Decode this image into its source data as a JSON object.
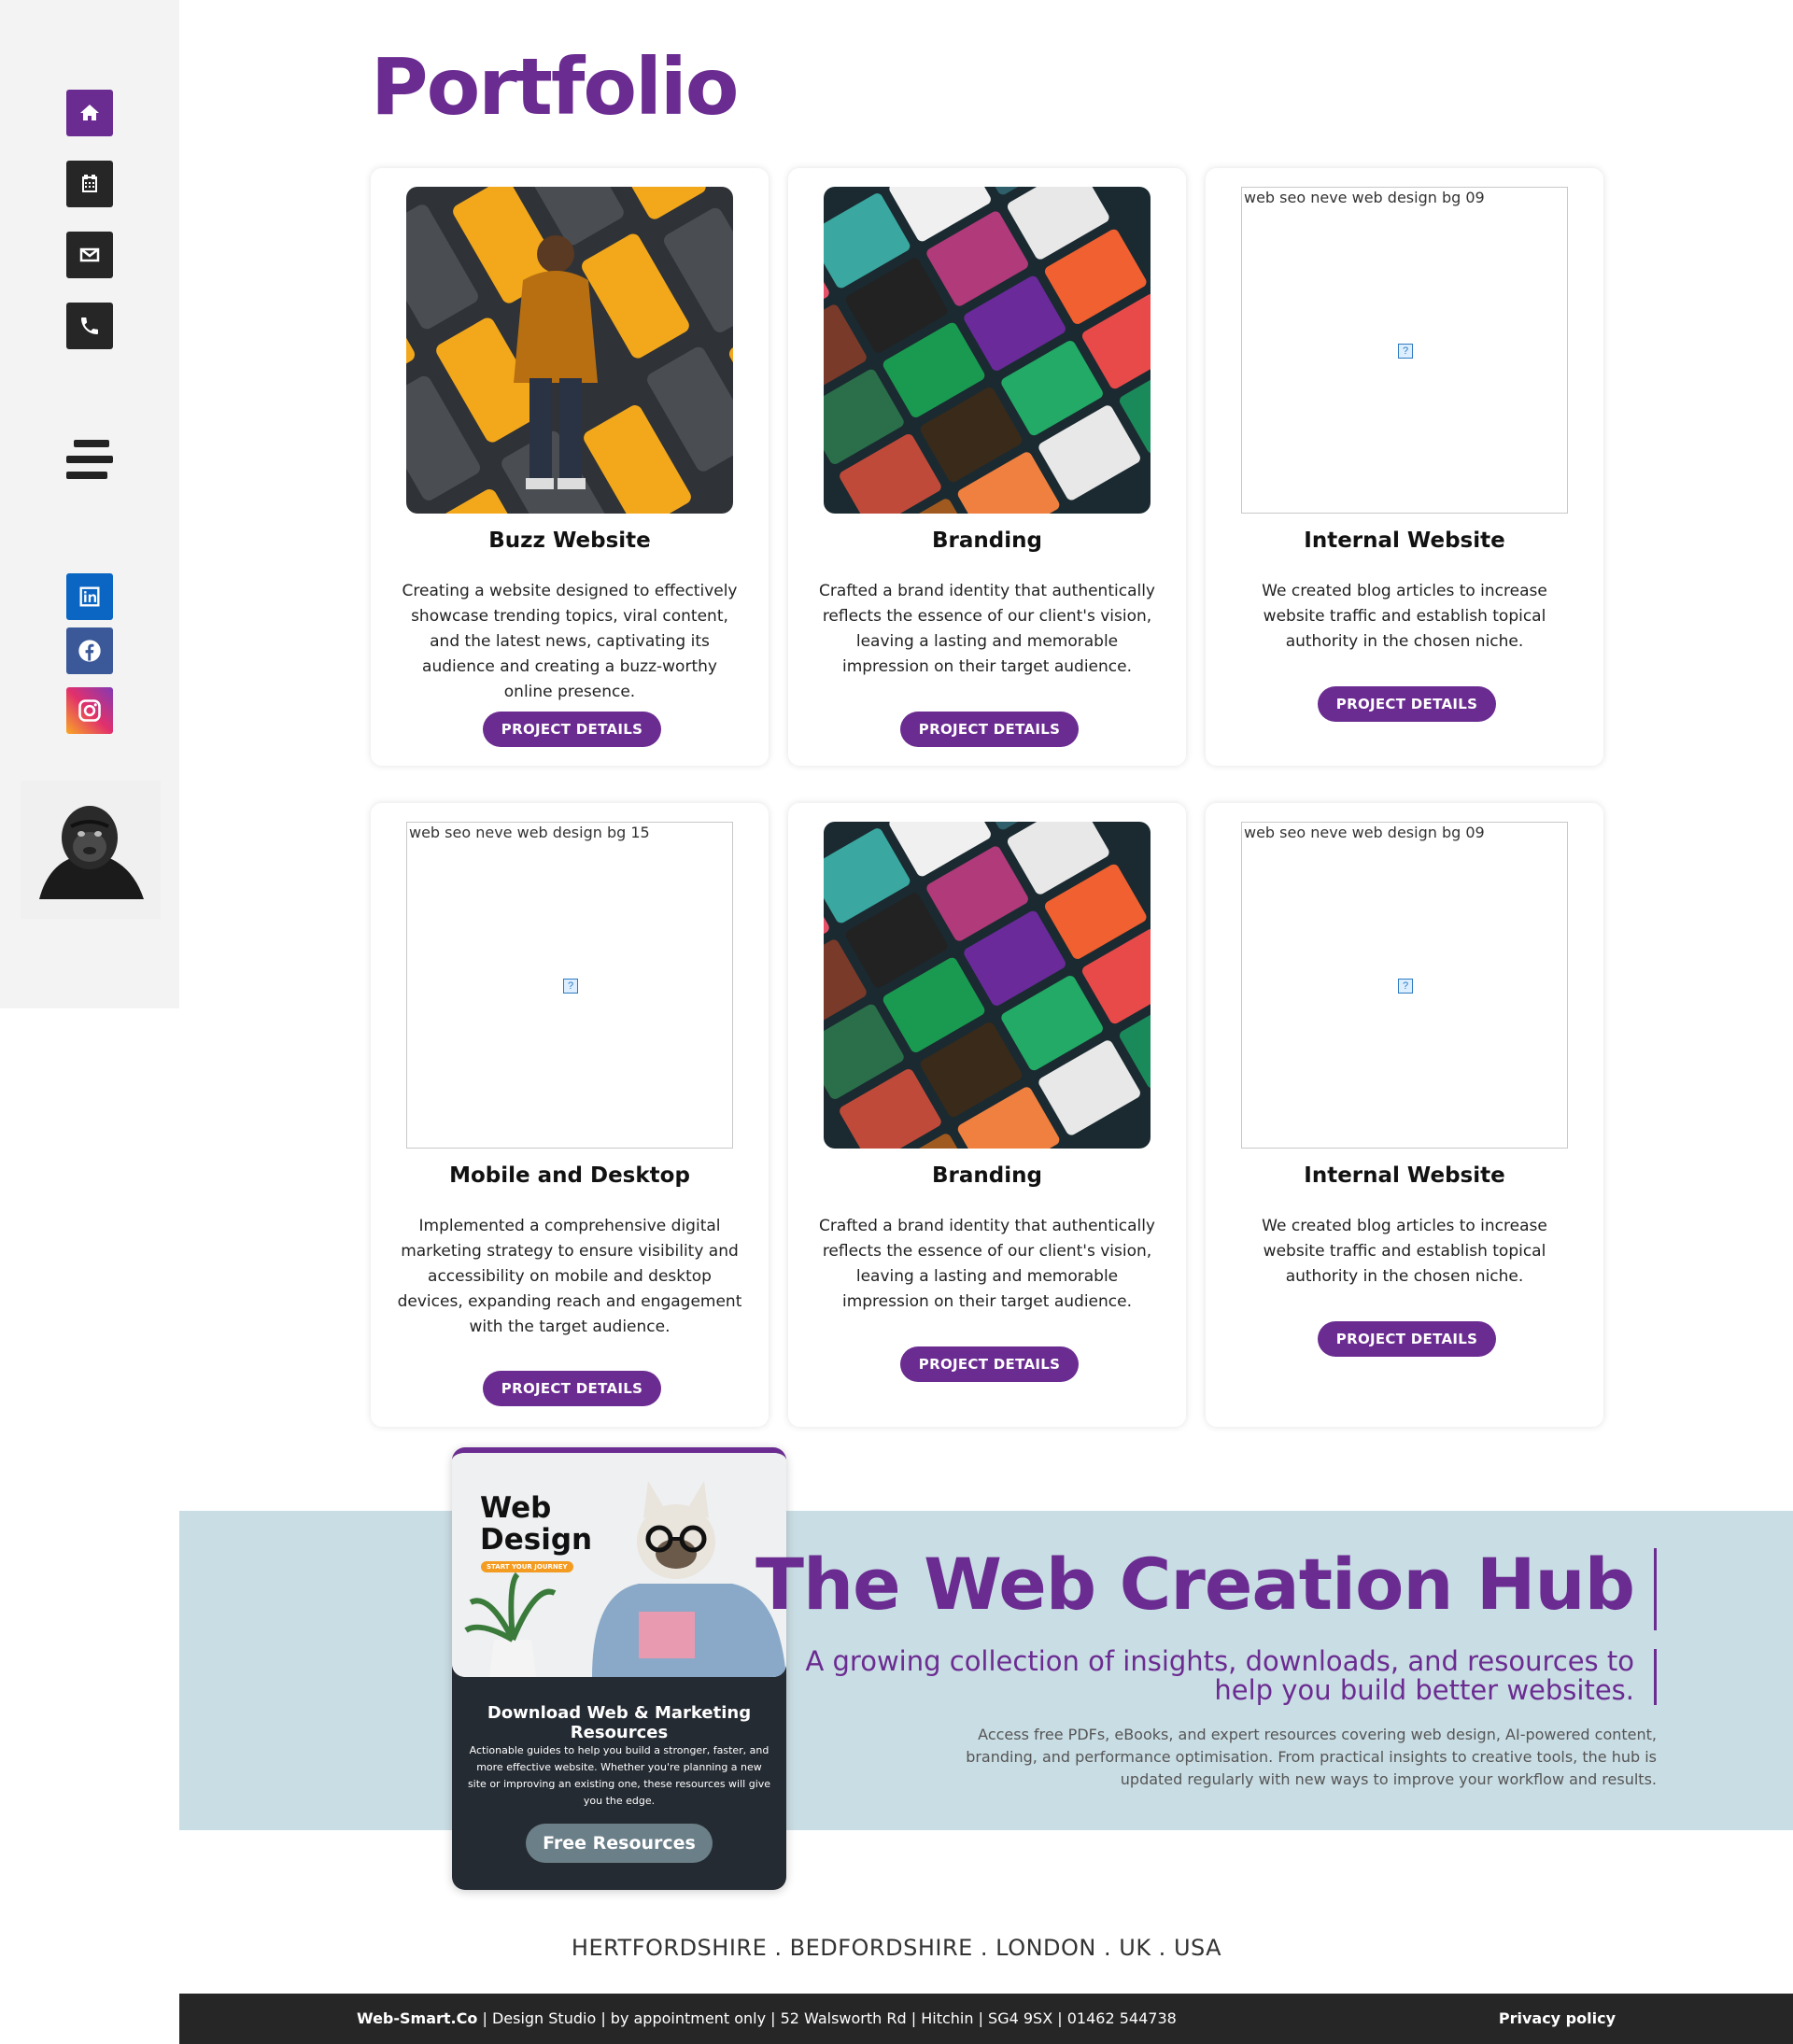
{
  "portfolio": {
    "title": "Portfolio",
    "cards": [
      {
        "title": "Buzz Website",
        "description": "Creating a website designed to effectively showcase trending topics, viral content, and the latest news, captivating its audience and creating a buzz-worthy online presence.",
        "button": "PROJECT DETAILS"
      },
      {
        "title": "Branding",
        "description": "Crafted a brand identity that authentically reflects the essence of our client's vision, leaving a lasting and memorable impression on their target audience.",
        "button": "PROJECT DETAILS"
      },
      {
        "title": "Internal Website",
        "image_alt": "web seo neve web design bg 09",
        "description": "We created blog articles to increase website traffic and establish topical authority in the chosen niche.",
        "button": "PROJECT DETAILS"
      },
      {
        "title": "Mobile and Desktop",
        "image_alt": "web seo neve web design bg 15",
        "description": "Implemented a comprehensive digital marketing strategy to ensure visibility and accessibility on mobile and desktop devices, expanding reach and engagement with the target audience.",
        "button": "PROJECT DETAILS"
      },
      {
        "title": "Branding",
        "description": "Crafted a brand identity that authentically reflects the essence of our client's vision, leaving a lasting and memorable impression on their target audience.",
        "button": "PROJECT DETAILS"
      },
      {
        "title": "Internal Website",
        "image_alt": "web seo neve web design bg 09",
        "description": "We created blog articles to increase website traffic and establish topical authority in the chosen niche.",
        "button": "PROJECT DETAILS"
      }
    ]
  },
  "sidebar": {
    "nav_icons": [
      "home-icon",
      "calendar-icon",
      "mail-icon",
      "phone-icon"
    ],
    "social_icons": [
      "linkedin-icon",
      "facebook-icon",
      "instagram-icon"
    ]
  },
  "promo": {
    "image_text_line1": "Web",
    "image_text_line2": "Design",
    "image_badge": "START YOUR JOURNEY",
    "heading": "Download Web & Marketing Resources",
    "text": "Actionable guides to help you build a stronger, faster, and more effective website. Whether you're planning a new site or improving an existing one, these resources will give you the edge.",
    "button": "Free Resources"
  },
  "hub": {
    "title": "The Web Creation Hub",
    "subtitle": "A growing collection of insights, downloads, and resources to help you build better websites.",
    "description": "Access free PDFs, eBooks, and expert resources covering web design, AI-powered content, branding, and performance optimisation. From practical insights to creative tools, the hub is updated regularly with new ways to improve your workflow and results."
  },
  "locations": "HERTFORDSHIRE . BEDFORDSHIRE . LONDON . UK . USA",
  "footer": {
    "brand": "Web-Smart.Co",
    "info": " | Design Studio | by appointment only | 52 Walsworth Rd | Hitchin | SG4 9SX | 01462 544738",
    "privacy": "Privacy policy"
  },
  "colors": {
    "accent": "#6b2c91",
    "sidebar_bg": "#f3f3f3",
    "dark": "#262626",
    "hub_bg": "#c9dde4",
    "linkedin": "#0a66c2",
    "facebook": "#3b5998"
  }
}
